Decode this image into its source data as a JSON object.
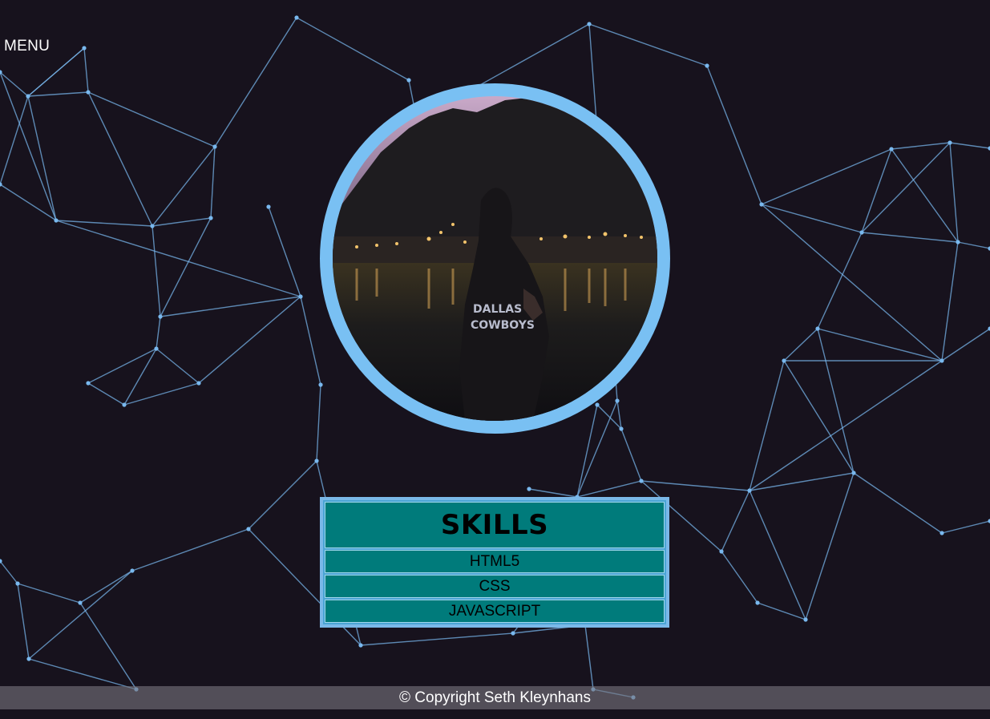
{
  "nav": {
    "menu_label": "MENU"
  },
  "profile": {
    "photo_alt": "Profile photo"
  },
  "skills": {
    "title": "SKILLS",
    "items": [
      "HTML5",
      "CSS",
      "JAVASCRIPT"
    ]
  },
  "footer": {
    "copyright": "© Copyright Seth Kleynhans"
  },
  "colors": {
    "background": "#17121d",
    "network_line": "#79b8ee",
    "accent_ring": "#79c0f3",
    "skills_cell": "#007b7b"
  }
}
